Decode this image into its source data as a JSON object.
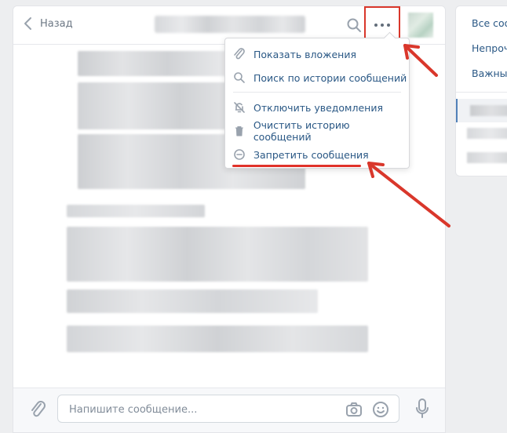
{
  "header": {
    "back_label": "Назад"
  },
  "menu": {
    "items": [
      {
        "label": "Показать вложения",
        "icon": "paperclip-icon"
      },
      {
        "label": "Поиск по истории сообщений",
        "icon": "search-icon"
      },
      {
        "label": "Отключить уведомления",
        "icon": "bell-off-icon"
      },
      {
        "label": "Очистить историю сообщений",
        "icon": "trash-icon"
      },
      {
        "label": "Запретить сообщения",
        "icon": "minus-circle-icon"
      }
    ]
  },
  "composer": {
    "placeholder": "Напишите сообщение..."
  },
  "right_panel": {
    "filters": [
      "Все сооб",
      "Непроч",
      "Важны"
    ]
  },
  "colors": {
    "accent": "#2a5885",
    "annotation_red": "#d9372b",
    "icon_gray": "#99a2ad"
  }
}
